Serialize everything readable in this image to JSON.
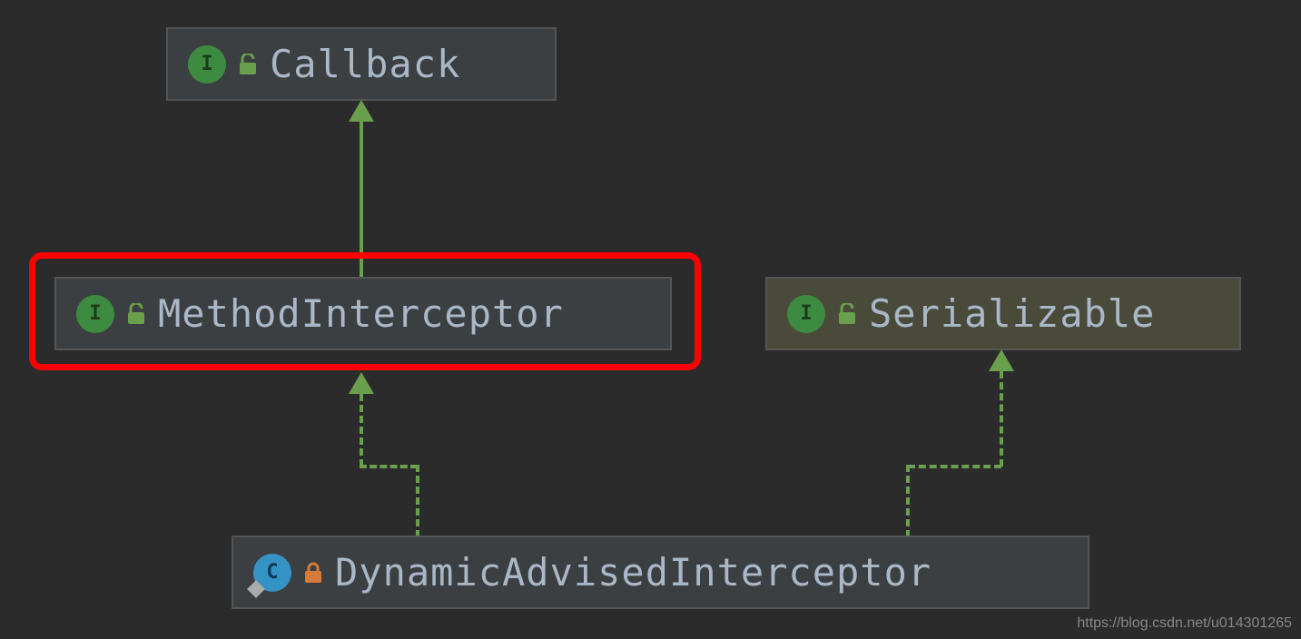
{
  "nodes": {
    "callback": {
      "name": "Callback",
      "kind": "I",
      "lock": "open"
    },
    "methodInterceptor": {
      "name": "MethodInterceptor",
      "kind": "I",
      "lock": "open"
    },
    "serializable": {
      "name": "Serializable",
      "kind": "I",
      "lock": "open"
    },
    "dynamicAdvisedInterceptor": {
      "name": "DynamicAdvisedInterceptor",
      "kind": "C",
      "lock": "closed"
    }
  },
  "watermark": "https://blog.csdn.net/u014301265",
  "colors": {
    "interface": "#3d8b40",
    "class": "#3592c4",
    "highlight": "#ff0000",
    "arrow": "#6a9f4d",
    "lockOpen": "#6a9f4d",
    "lockClosed": "#d67b3a"
  },
  "relations": [
    {
      "from": "MethodInterceptor",
      "to": "Callback",
      "style": "solid"
    },
    {
      "from": "DynamicAdvisedInterceptor",
      "to": "MethodInterceptor",
      "style": "dashed"
    },
    {
      "from": "DynamicAdvisedInterceptor",
      "to": "Serializable",
      "style": "dashed"
    }
  ]
}
